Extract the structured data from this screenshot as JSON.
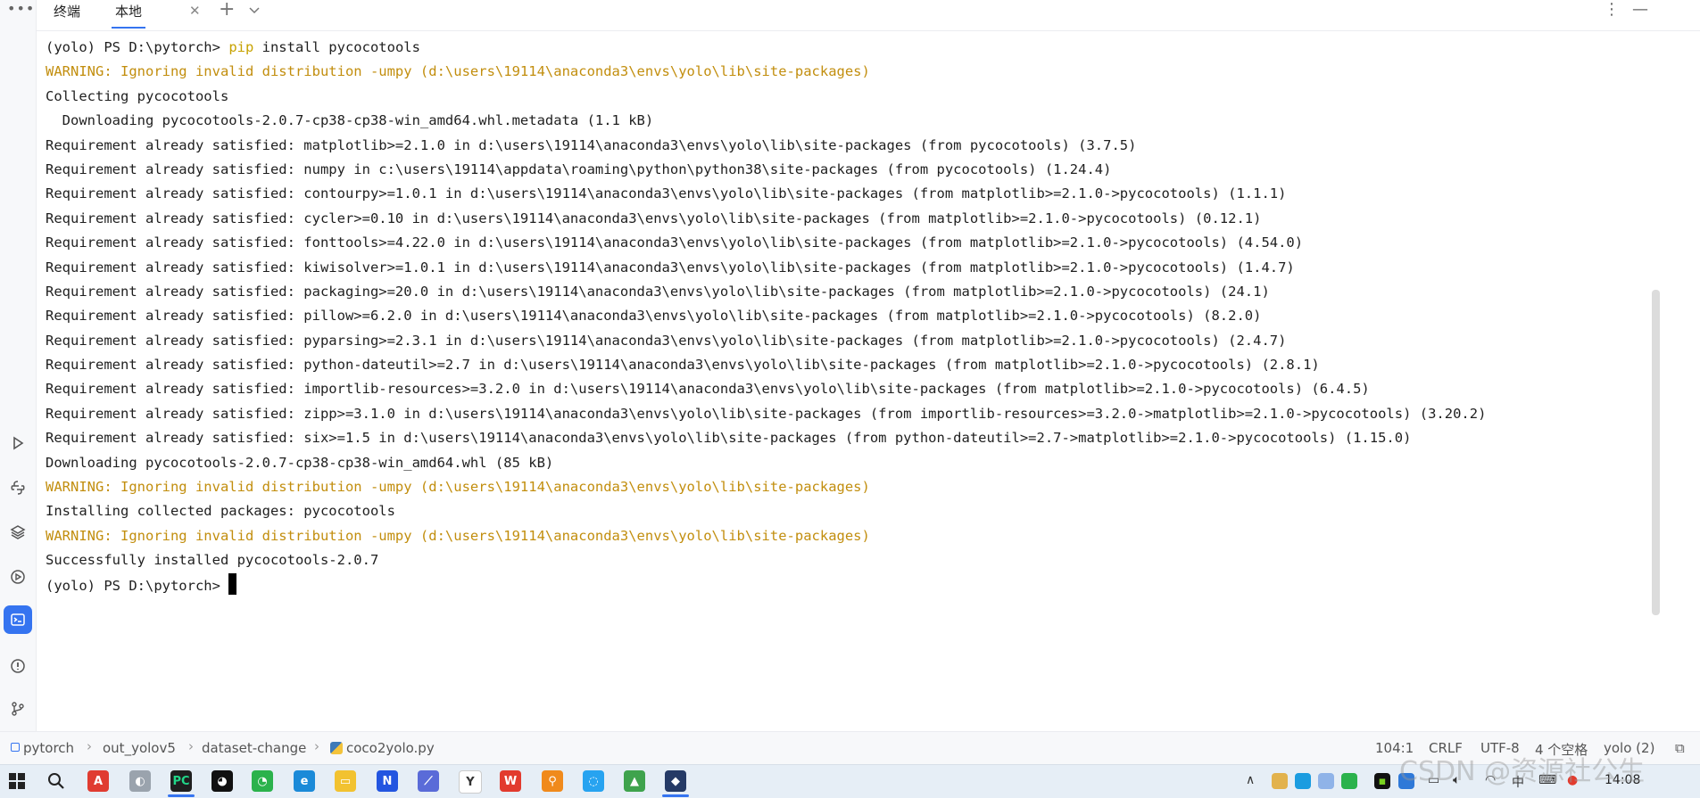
{
  "tabs": {
    "terminal_label": "终端",
    "local_label": "本地"
  },
  "terminal": {
    "lines": [
      {
        "type": "prompt",
        "prompt": "(yolo) PS D:\\pytorch> ",
        "cmd": "pip",
        "rest": " install pycocotools"
      },
      {
        "type": "warn",
        "text": "WARNING: Ignoring invalid distribution -umpy (d:\\users\\19114\\anaconda3\\envs\\yolo\\lib\\site-packages)"
      },
      {
        "type": "normal",
        "text": "Collecting pycocotools"
      },
      {
        "type": "normal",
        "text": "  Downloading pycocotools-2.0.7-cp38-cp38-win_amd64.whl.metadata (1.1 kB)"
      },
      {
        "type": "normal",
        "text": "Requirement already satisfied: matplotlib>=2.1.0 in d:\\users\\19114\\anaconda3\\envs\\yolo\\lib\\site-packages (from pycocotools) (3.7.5)"
      },
      {
        "type": "normal",
        "text": "Requirement already satisfied: numpy in c:\\users\\19114\\appdata\\roaming\\python\\python38\\site-packages (from pycocotools) (1.24.4)"
      },
      {
        "type": "normal",
        "text": "Requirement already satisfied: contourpy>=1.0.1 in d:\\users\\19114\\anaconda3\\envs\\yolo\\lib\\site-packages (from matplotlib>=2.1.0->pycocotools) (1.1.1)"
      },
      {
        "type": "normal",
        "text": "Requirement already satisfied: cycler>=0.10 in d:\\users\\19114\\anaconda3\\envs\\yolo\\lib\\site-packages (from matplotlib>=2.1.0->pycocotools) (0.12.1)"
      },
      {
        "type": "normal",
        "text": "Requirement already satisfied: fonttools>=4.22.0 in d:\\users\\19114\\anaconda3\\envs\\yolo\\lib\\site-packages (from matplotlib>=2.1.0->pycocotools) (4.54.0)"
      },
      {
        "type": "normal",
        "text": "Requirement already satisfied: kiwisolver>=1.0.1 in d:\\users\\19114\\anaconda3\\envs\\yolo\\lib\\site-packages (from matplotlib>=2.1.0->pycocotools) (1.4.7)"
      },
      {
        "type": "normal",
        "text": "Requirement already satisfied: packaging>=20.0 in d:\\users\\19114\\anaconda3\\envs\\yolo\\lib\\site-packages (from matplotlib>=2.1.0->pycocotools) (24.1)"
      },
      {
        "type": "normal",
        "text": "Requirement already satisfied: pillow>=6.2.0 in d:\\users\\19114\\anaconda3\\envs\\yolo\\lib\\site-packages (from matplotlib>=2.1.0->pycocotools) (8.2.0)"
      },
      {
        "type": "normal",
        "text": "Requirement already satisfied: pyparsing>=2.3.1 in d:\\users\\19114\\anaconda3\\envs\\yolo\\lib\\site-packages (from matplotlib>=2.1.0->pycocotools) (2.4.7)"
      },
      {
        "type": "normal",
        "text": "Requirement already satisfied: python-dateutil>=2.7 in d:\\users\\19114\\anaconda3\\envs\\yolo\\lib\\site-packages (from matplotlib>=2.1.0->pycocotools) (2.8.1)"
      },
      {
        "type": "normal",
        "text": "Requirement already satisfied: importlib-resources>=3.2.0 in d:\\users\\19114\\anaconda3\\envs\\yolo\\lib\\site-packages (from matplotlib>=2.1.0->pycocotools) (6.4.5)"
      },
      {
        "type": "normal",
        "text": "Requirement already satisfied: zipp>=3.1.0 in d:\\users\\19114\\anaconda3\\envs\\yolo\\lib\\site-packages (from importlib-resources>=3.2.0->matplotlib>=2.1.0->pycocotools) (3.20.2)"
      },
      {
        "type": "normal",
        "text": "Requirement already satisfied: six>=1.5 in d:\\users\\19114\\anaconda3\\envs\\yolo\\lib\\site-packages (from python-dateutil>=2.7->matplotlib>=2.1.0->pycocotools) (1.15.0)"
      },
      {
        "type": "normal",
        "text": "Downloading pycocotools-2.0.7-cp38-cp38-win_amd64.whl (85 kB)"
      },
      {
        "type": "warn",
        "text": "WARNING: Ignoring invalid distribution -umpy (d:\\users\\19114\\anaconda3\\envs\\yolo\\lib\\site-packages)"
      },
      {
        "type": "normal",
        "text": "Installing collected packages: pycocotools"
      },
      {
        "type": "warn",
        "text": "WARNING: Ignoring invalid distribution -umpy (d:\\users\\19114\\anaconda3\\envs\\yolo\\lib\\site-packages)"
      },
      {
        "type": "normal",
        "text": "Successfully installed pycocotools-2.0.7"
      },
      {
        "type": "cursor",
        "prompt": "(yolo) PS D:\\pytorch> "
      }
    ]
  },
  "breadcrumb": {
    "items": [
      "pytorch",
      "out_yolov5",
      "dataset-change",
      "coco2yolo.py"
    ]
  },
  "status": {
    "position": "104:1",
    "line_ending": "CRLF",
    "encoding": "UTF-8",
    "indent": "4 个空格",
    "interpreter": "yolo (2)"
  },
  "taskbar": {
    "clock": "14:08"
  },
  "watermark": "CSDN @资源社公生",
  "colors": {
    "accent": "#3574f0",
    "warning_text": "#c28e0e",
    "command_text": "#c7a200"
  }
}
